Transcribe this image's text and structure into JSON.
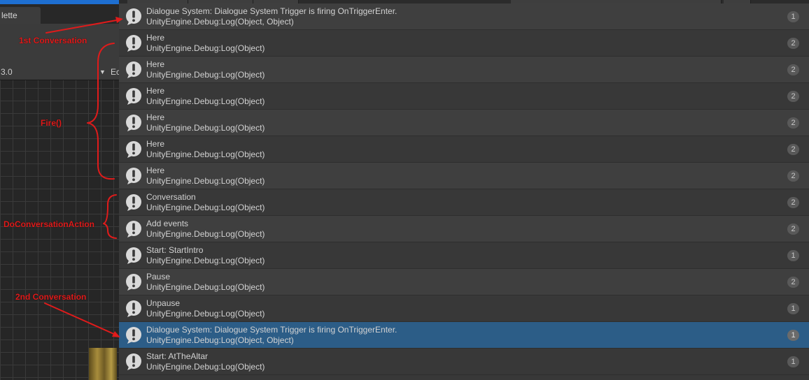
{
  "background_editor": {
    "tab_label": "lette",
    "field_value": "3.0",
    "dropdown_glyph": "▼",
    "label2": "Ec"
  },
  "console": {
    "rows": [
      {
        "message": "Dialogue System: Dialogue System Trigger is firing OnTriggerEnter.",
        "source": "UnityEngine.Debug:Log(Object, Object)",
        "count": "1",
        "selected": false
      },
      {
        "message": "Here",
        "source": "UnityEngine.Debug:Log(Object)",
        "count": "2",
        "selected": false
      },
      {
        "message": "Here",
        "source": "UnityEngine.Debug:Log(Object)",
        "count": "2",
        "selected": false
      },
      {
        "message": "Here",
        "source": "UnityEngine.Debug:Log(Object)",
        "count": "2",
        "selected": false
      },
      {
        "message": "Here",
        "source": "UnityEngine.Debug:Log(Object)",
        "count": "2",
        "selected": false
      },
      {
        "message": "Here",
        "source": "UnityEngine.Debug:Log(Object)",
        "count": "2",
        "selected": false
      },
      {
        "message": "Here",
        "source": "UnityEngine.Debug:Log(Object)",
        "count": "2",
        "selected": false
      },
      {
        "message": "Conversation",
        "source": "UnityEngine.Debug:Log(Object)",
        "count": "2",
        "selected": false
      },
      {
        "message": "Add events",
        "source": "UnityEngine.Debug:Log(Object)",
        "count": "2",
        "selected": false
      },
      {
        "message": "Start: StartIntro",
        "source": "UnityEngine.Debug:Log(Object)",
        "count": "1",
        "selected": false
      },
      {
        "message": "Pause",
        "source": "UnityEngine.Debug:Log(Object)",
        "count": "2",
        "selected": false
      },
      {
        "message": "Unpause",
        "source": "UnityEngine.Debug:Log(Object)",
        "count": "1",
        "selected": false
      },
      {
        "message": "Dialogue System: Dialogue System Trigger is firing OnTriggerEnter.",
        "source": "UnityEngine.Debug:Log(Object, Object)",
        "count": "1",
        "selected": true
      },
      {
        "message": "Start: AtTheAltar",
        "source": "UnityEngine.Debug:Log(Object)",
        "count": "1",
        "selected": false
      }
    ]
  },
  "annotations": {
    "first_conversation": "1st Conversation",
    "fire": "Fire()",
    "do_conversation_action": "DoConversationAction",
    "second_conversation": "2nd Conversation",
    "color": "#e01b1b"
  },
  "icons": {
    "row_icon": "warning-icon"
  }
}
